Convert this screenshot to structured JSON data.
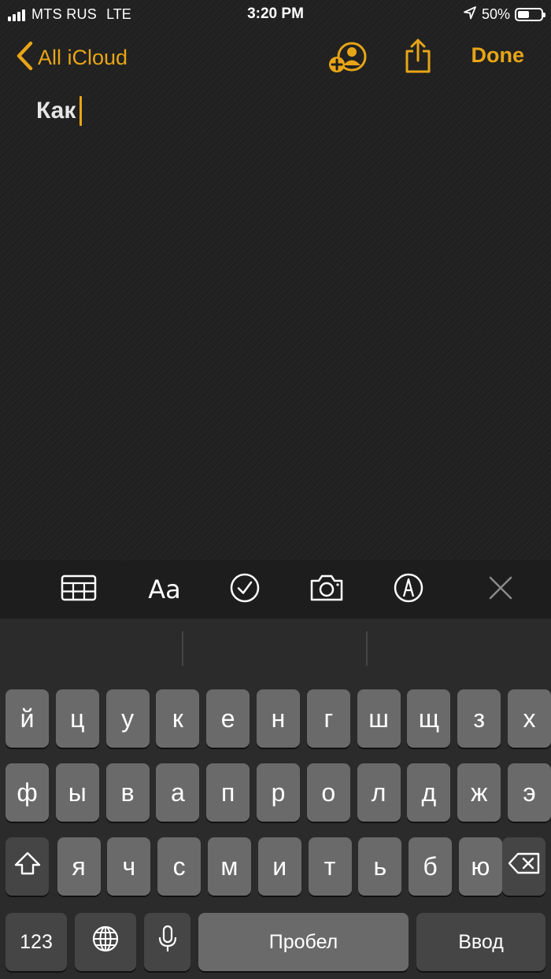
{
  "status": {
    "carrier": "MTS RUS",
    "network": "LTE",
    "time": "3:20 PM",
    "battery_text": "50%",
    "battery_level": 0.5
  },
  "nav": {
    "back_label": "All iCloud",
    "done_label": "Done",
    "icons": [
      "chevron-left-icon",
      "add-person-icon",
      "share-icon"
    ]
  },
  "note": {
    "text": "Как"
  },
  "toolbar": {
    "format_label": "Aa",
    "icons": [
      "table-icon",
      "format-icon",
      "checklist-icon",
      "camera-icon",
      "markup-icon",
      "close-icon"
    ]
  },
  "keyboard": {
    "row1": [
      "й",
      "ц",
      "у",
      "к",
      "е",
      "н",
      "г",
      "ш",
      "щ",
      "з",
      "х"
    ],
    "row2": [
      "ф",
      "ы",
      "в",
      "а",
      "п",
      "р",
      "о",
      "л",
      "д",
      "ж",
      "э"
    ],
    "row3": [
      "я",
      "ч",
      "с",
      "м",
      "и",
      "т",
      "ь",
      "б",
      "ю"
    ],
    "numbers_label": "123",
    "space_label": "Пробел",
    "return_label": "Ввод",
    "icons": [
      "shift-icon",
      "backspace-icon",
      "globe-icon",
      "microphone-icon"
    ]
  },
  "colors": {
    "accent": "#e7a516",
    "background": "#1f1f1f",
    "key": "#6a6a6a",
    "key_dark": "#454545"
  }
}
